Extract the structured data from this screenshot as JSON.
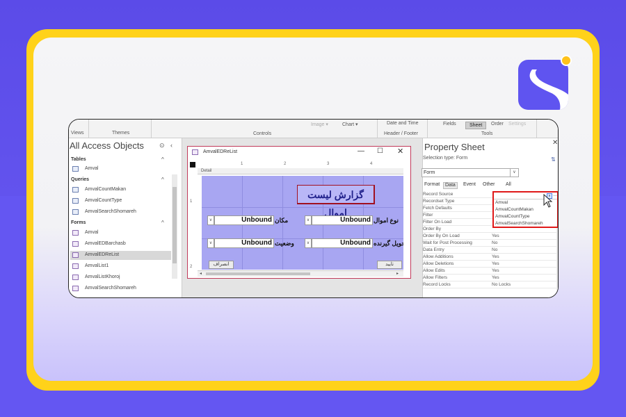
{
  "colors": {
    "background": "#5b4be8",
    "frame": "#ffd21a",
    "logo": "#5f54f0",
    "logo_dot": "#ffc21a",
    "canvas": "#a8a6f2",
    "highlight": "#e01818",
    "form_title": "#20208a"
  },
  "ribbon": {
    "views": "Views",
    "themes": "Themes",
    "controls": "Controls",
    "image": "Image ▾",
    "chart": "Chart ▾",
    "date_time": "Date and Time",
    "header_footer": "Header / Footer",
    "fields": "Fields",
    "sheet": "Sheet",
    "order": "Order",
    "settings": "Settings",
    "tools": "Tools"
  },
  "nav": {
    "title": "All Access Objects",
    "groups": {
      "tables": "Tables",
      "queries": "Queries",
      "forms": "Forms"
    },
    "tables": [
      "Amval"
    ],
    "queries": [
      "AmvalCountMakan",
      "AmvalCountType",
      "AmvalSearchShomareh"
    ],
    "forms": [
      "Amval",
      "AmvalEDBarchasb",
      "AmvalEDReList",
      "AmvalList1",
      "AmvalListKhoroj",
      "AmvalSearchShomareh"
    ],
    "selected_form": "AmvalEDReList"
  },
  "form_window": {
    "title": "AmvalEDReList",
    "detail_label": "Detail",
    "ruler_marks": [
      "1",
      "2",
      "3",
      "4"
    ],
    "left_marks": [
      "1",
      "2"
    ],
    "form_title": "گزارش لیست اموال",
    "fields": [
      {
        "label": "مکان",
        "value": "Unbound"
      },
      {
        "label": "نوع اموال",
        "value": "Unbound"
      },
      {
        "label": "وضعیت",
        "value": "Unbound"
      },
      {
        "label": "تحویل گیرنده",
        "value": "Unbound"
      }
    ],
    "button_left": "انصراف",
    "button_right": "تایید"
  },
  "property_sheet": {
    "title": "Property Sheet",
    "selection_type": "Selection type:  Form",
    "selector_value": "Form",
    "tabs": [
      "Format",
      "Data",
      "Event",
      "Other",
      "All"
    ],
    "active_tab": "Data",
    "rows": [
      {
        "key": "Record Source",
        "value": ""
      },
      {
        "key": "Recordset Type",
        "value": ""
      },
      {
        "key": "Fetch Defaults",
        "value": ""
      },
      {
        "key": "Filter",
        "value": ""
      },
      {
        "key": "Filter On Load",
        "value": ""
      },
      {
        "key": "Order By",
        "value": ""
      },
      {
        "key": "Order By On Load",
        "value": "Yes"
      },
      {
        "key": "Wait for Post Processing",
        "value": "No"
      },
      {
        "key": "Data Entry",
        "value": "No"
      },
      {
        "key": "Allow Additions",
        "value": "Yes"
      },
      {
        "key": "Allow Deletions",
        "value": "Yes"
      },
      {
        "key": "Allow Edits",
        "value": "Yes"
      },
      {
        "key": "Allow Filters",
        "value": "Yes"
      },
      {
        "key": "Record Locks",
        "value": "No Locks"
      }
    ],
    "record_source_options": [
      "Amval",
      "AmvalCountMakan",
      "AmvalCountType",
      "AmvalSearchShomareh"
    ]
  }
}
